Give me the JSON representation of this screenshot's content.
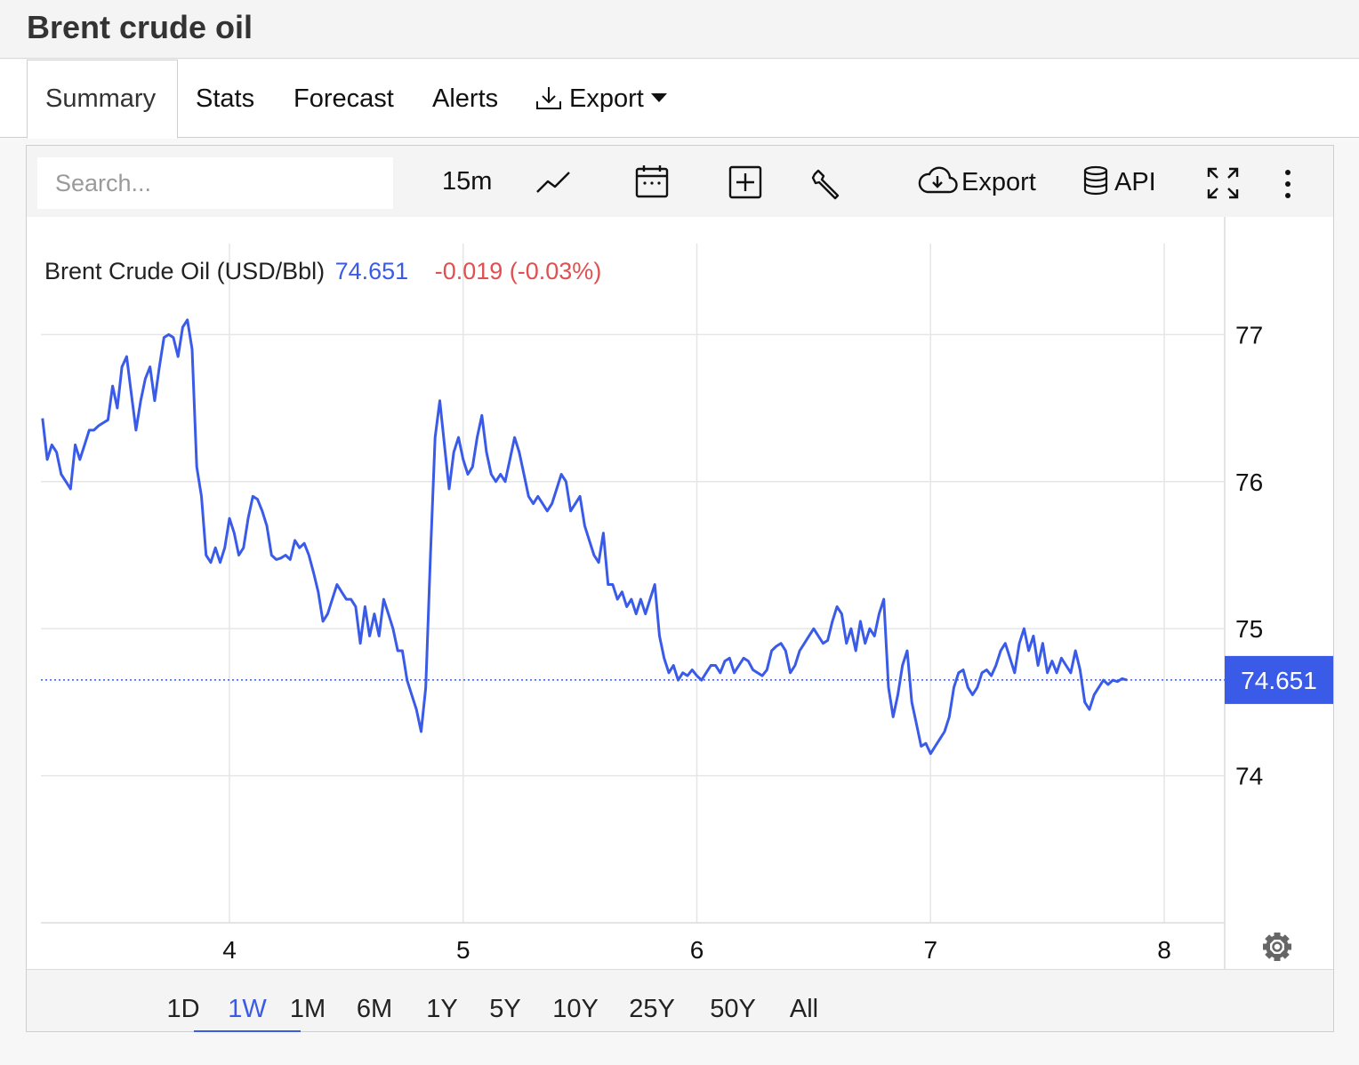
{
  "page": {
    "title": "Brent crude oil"
  },
  "tabs": [
    {
      "label": "Summary",
      "active": true
    },
    {
      "label": "Stats"
    },
    {
      "label": "Forecast"
    },
    {
      "label": "Alerts"
    },
    {
      "label": "Export",
      "icon": "download-icon",
      "dropdown": true
    }
  ],
  "toolbar": {
    "search_placeholder": "Search...",
    "interval": "15m",
    "export_label": "Export",
    "api_label": "API",
    "icons": [
      "line-chart-icon",
      "calendar-icon",
      "add-box-icon",
      "wrench-icon",
      "cloud-download-icon",
      "database-icon",
      "fullscreen-icon",
      "more-vertical-icon"
    ]
  },
  "legend": {
    "name": "Brent Crude Oil (USD/Bbl)",
    "price": "74.651",
    "change": "-0.019 (-0.03%)"
  },
  "ranges": {
    "items": [
      "1D",
      "1W",
      "1M",
      "6M",
      "1Y",
      "5Y",
      "10Y",
      "25Y",
      "50Y",
      "All"
    ],
    "active": "1W"
  },
  "colors": {
    "line": "#3a5be8",
    "price_tag_bg": "#3a5be8",
    "negative": "#e05050",
    "grid": "#e6e6e6"
  },
  "chart_data": {
    "type": "line",
    "ylim": [
      73.0,
      77.8
    ],
    "xlim": [
      3.2,
      8.25
    ],
    "x_ticks": [
      4,
      5,
      6,
      7,
      8
    ],
    "x_tick_labels": [
      "4",
      "5",
      "6",
      "7",
      "8"
    ],
    "y_ticks": [
      74,
      75,
      76,
      77
    ],
    "y_tick_labels": [
      "74",
      "75",
      "76",
      "77"
    ],
    "last_value": 74.651,
    "last_value_label": "74.651",
    "grid": true,
    "series": [
      {
        "points": [
          [
            3.2,
            76.43
          ],
          [
            3.22,
            76.15
          ],
          [
            3.24,
            76.25
          ],
          [
            3.26,
            76.2
          ],
          [
            3.28,
            76.05
          ],
          [
            3.3,
            76.0
          ],
          [
            3.32,
            75.95
          ],
          [
            3.34,
            76.25
          ],
          [
            3.36,
            76.15
          ],
          [
            3.38,
            76.25
          ],
          [
            3.4,
            76.35
          ],
          [
            3.42,
            76.35
          ],
          [
            3.44,
            76.38
          ],
          [
            3.46,
            76.4
          ],
          [
            3.48,
            76.42
          ],
          [
            3.5,
            76.65
          ],
          [
            3.52,
            76.5
          ],
          [
            3.54,
            76.78
          ],
          [
            3.56,
            76.85
          ],
          [
            3.58,
            76.6
          ],
          [
            3.6,
            76.35
          ],
          [
            3.62,
            76.55
          ],
          [
            3.64,
            76.7
          ],
          [
            3.66,
            76.78
          ],
          [
            3.68,
            76.55
          ],
          [
            3.7,
            76.78
          ],
          [
            3.72,
            76.98
          ],
          [
            3.74,
            77.0
          ],
          [
            3.76,
            76.98
          ],
          [
            3.78,
            76.85
          ],
          [
            3.8,
            77.05
          ],
          [
            3.82,
            77.1
          ],
          [
            3.84,
            76.9
          ],
          [
            3.86,
            76.1
          ],
          [
            3.88,
            75.9
          ],
          [
            3.9,
            75.5
          ],
          [
            3.92,
            75.45
          ],
          [
            3.94,
            75.55
          ],
          [
            3.96,
            75.45
          ],
          [
            3.98,
            75.55
          ],
          [
            4.0,
            75.75
          ],
          [
            4.02,
            75.65
          ],
          [
            4.04,
            75.5
          ],
          [
            4.06,
            75.55
          ],
          [
            4.08,
            75.75
          ],
          [
            4.1,
            75.9
          ],
          [
            4.12,
            75.88
          ],
          [
            4.14,
            75.8
          ],
          [
            4.16,
            75.7
          ],
          [
            4.18,
            75.5
          ],
          [
            4.2,
            75.47
          ],
          [
            4.22,
            75.48
          ],
          [
            4.24,
            75.5
          ],
          [
            4.26,
            75.47
          ],
          [
            4.28,
            75.6
          ],
          [
            4.3,
            75.55
          ],
          [
            4.32,
            75.58
          ],
          [
            4.34,
            75.5
          ],
          [
            4.36,
            75.38
          ],
          [
            4.38,
            75.25
          ],
          [
            4.4,
            75.05
          ],
          [
            4.42,
            75.1
          ],
          [
            4.44,
            75.2
          ],
          [
            4.46,
            75.3
          ],
          [
            4.48,
            75.25
          ],
          [
            4.5,
            75.2
          ],
          [
            4.52,
            75.2
          ],
          [
            4.54,
            75.15
          ],
          [
            4.56,
            74.9
          ],
          [
            4.58,
            75.15
          ],
          [
            4.6,
            74.95
          ],
          [
            4.62,
            75.1
          ],
          [
            4.64,
            74.95
          ],
          [
            4.66,
            75.2
          ],
          [
            4.68,
            75.1
          ],
          [
            4.7,
            75.0
          ],
          [
            4.72,
            74.85
          ],
          [
            4.74,
            74.85
          ],
          [
            4.76,
            74.65
          ],
          [
            4.78,
            74.55
          ],
          [
            4.8,
            74.45
          ],
          [
            4.82,
            74.3
          ],
          [
            4.84,
            74.6
          ],
          [
            4.86,
            75.5
          ],
          [
            4.88,
            76.3
          ],
          [
            4.9,
            76.55
          ],
          [
            4.92,
            76.25
          ],
          [
            4.94,
            75.95
          ],
          [
            4.96,
            76.2
          ],
          [
            4.98,
            76.3
          ],
          [
            5.0,
            76.15
          ],
          [
            5.02,
            76.05
          ],
          [
            5.04,
            76.1
          ],
          [
            5.06,
            76.3
          ],
          [
            5.08,
            76.45
          ],
          [
            5.1,
            76.2
          ],
          [
            5.12,
            76.05
          ],
          [
            5.14,
            76.0
          ],
          [
            5.16,
            76.05
          ],
          [
            5.18,
            76.0
          ],
          [
            5.2,
            76.15
          ],
          [
            5.22,
            76.3
          ],
          [
            5.24,
            76.2
          ],
          [
            5.26,
            76.05
          ],
          [
            5.28,
            75.9
          ],
          [
            5.3,
            75.85
          ],
          [
            5.32,
            75.9
          ],
          [
            5.34,
            75.85
          ],
          [
            5.36,
            75.8
          ],
          [
            5.38,
            75.85
          ],
          [
            5.4,
            75.95
          ],
          [
            5.42,
            76.05
          ],
          [
            5.44,
            76.0
          ],
          [
            5.46,
            75.8
          ],
          [
            5.48,
            75.85
          ],
          [
            5.5,
            75.9
          ],
          [
            5.52,
            75.7
          ],
          [
            5.54,
            75.6
          ],
          [
            5.56,
            75.5
          ],
          [
            5.58,
            75.45
          ],
          [
            5.6,
            75.65
          ],
          [
            5.62,
            75.3
          ],
          [
            5.64,
            75.3
          ],
          [
            5.66,
            75.2
          ],
          [
            5.68,
            75.25
          ],
          [
            5.7,
            75.15
          ],
          [
            5.72,
            75.2
          ],
          [
            5.74,
            75.1
          ],
          [
            5.76,
            75.2
          ],
          [
            5.78,
            75.1
          ],
          [
            5.8,
            75.2
          ],
          [
            5.82,
            75.3
          ],
          [
            5.84,
            74.95
          ],
          [
            5.86,
            74.8
          ],
          [
            5.88,
            74.7
          ],
          [
            5.9,
            74.75
          ],
          [
            5.92,
            74.65
          ],
          [
            5.94,
            74.7
          ],
          [
            5.96,
            74.68
          ],
          [
            5.98,
            74.72
          ],
          [
            6.0,
            74.68
          ],
          [
            6.02,
            74.65
          ],
          [
            6.04,
            74.7
          ],
          [
            6.06,
            74.75
          ],
          [
            6.08,
            74.75
          ],
          [
            6.1,
            74.7
          ],
          [
            6.12,
            74.78
          ],
          [
            6.14,
            74.8
          ],
          [
            6.16,
            74.7
          ],
          [
            6.18,
            74.75
          ],
          [
            6.2,
            74.8
          ],
          [
            6.22,
            74.78
          ],
          [
            6.24,
            74.72
          ],
          [
            6.26,
            74.7
          ],
          [
            6.28,
            74.68
          ],
          [
            6.3,
            74.72
          ],
          [
            6.32,
            74.85
          ],
          [
            6.34,
            74.88
          ],
          [
            6.36,
            74.9
          ],
          [
            6.38,
            74.85
          ],
          [
            6.4,
            74.7
          ],
          [
            6.42,
            74.75
          ],
          [
            6.44,
            74.85
          ],
          [
            6.46,
            74.9
          ],
          [
            6.48,
            74.95
          ],
          [
            6.5,
            75.0
          ],
          [
            6.52,
            74.95
          ],
          [
            6.54,
            74.9
          ],
          [
            6.56,
            74.92
          ],
          [
            6.58,
            75.05
          ],
          [
            6.6,
            75.15
          ],
          [
            6.62,
            75.1
          ],
          [
            6.64,
            74.9
          ],
          [
            6.66,
            75.0
          ],
          [
            6.68,
            74.85
          ],
          [
            6.7,
            75.05
          ],
          [
            6.72,
            74.9
          ],
          [
            6.74,
            75.0
          ],
          [
            6.76,
            74.95
          ],
          [
            6.78,
            75.1
          ],
          [
            6.8,
            75.2
          ],
          [
            6.82,
            74.6
          ],
          [
            6.84,
            74.4
          ],
          [
            6.86,
            74.55
          ],
          [
            6.88,
            74.75
          ],
          [
            6.9,
            74.85
          ],
          [
            6.92,
            74.5
          ],
          [
            6.94,
            74.35
          ],
          [
            6.96,
            74.2
          ],
          [
            6.98,
            74.22
          ],
          [
            7.0,
            74.15
          ],
          [
            7.02,
            74.2
          ],
          [
            7.04,
            74.25
          ],
          [
            7.06,
            74.3
          ],
          [
            7.08,
            74.4
          ],
          [
            7.1,
            74.6
          ],
          [
            7.12,
            74.7
          ],
          [
            7.14,
            74.72
          ],
          [
            7.16,
            74.6
          ],
          [
            7.18,
            74.55
          ],
          [
            7.2,
            74.6
          ],
          [
            7.22,
            74.7
          ],
          [
            7.24,
            74.72
          ],
          [
            7.26,
            74.68
          ],
          [
            7.28,
            74.75
          ],
          [
            7.3,
            74.85
          ],
          [
            7.32,
            74.9
          ],
          [
            7.34,
            74.8
          ],
          [
            7.36,
            74.7
          ],
          [
            7.38,
            74.9
          ],
          [
            7.4,
            75.0
          ],
          [
            7.42,
            74.85
          ],
          [
            7.44,
            74.95
          ],
          [
            7.46,
            74.75
          ],
          [
            7.48,
            74.9
          ],
          [
            7.5,
            74.7
          ],
          [
            7.52,
            74.78
          ],
          [
            7.54,
            74.7
          ],
          [
            7.56,
            74.8
          ],
          [
            7.58,
            74.75
          ],
          [
            7.6,
            74.7
          ],
          [
            7.62,
            74.85
          ],
          [
            7.64,
            74.72
          ],
          [
            7.66,
            74.5
          ],
          [
            7.68,
            74.45
          ],
          [
            7.7,
            74.55
          ],
          [
            7.72,
            74.6
          ],
          [
            7.74,
            74.65
          ],
          [
            7.76,
            74.62
          ],
          [
            7.78,
            74.65
          ],
          [
            7.8,
            74.64
          ],
          [
            7.82,
            74.66
          ],
          [
            7.84,
            74.651
          ]
        ]
      }
    ]
  }
}
